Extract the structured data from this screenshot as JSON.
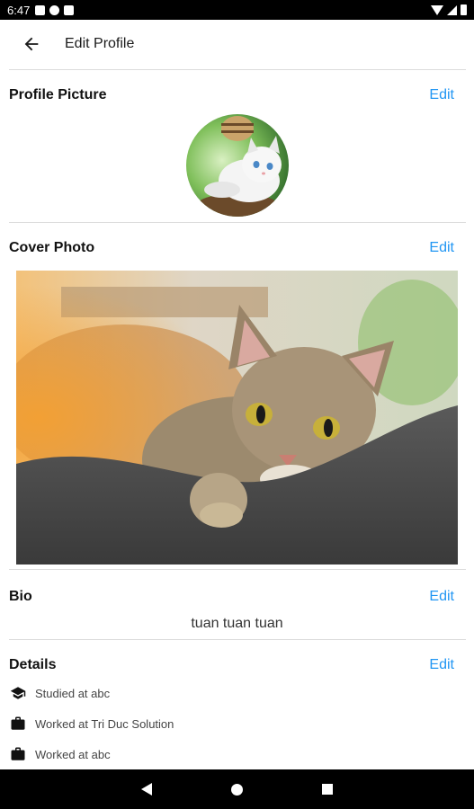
{
  "status_bar": {
    "time": "6:47"
  },
  "header": {
    "title": "Edit Profile"
  },
  "sections": {
    "profile_picture": {
      "title": "Profile Picture",
      "edit_label": "Edit"
    },
    "cover_photo": {
      "title": "Cover Photo",
      "edit_label": "Edit"
    },
    "bio": {
      "title": "Bio",
      "edit_label": "Edit",
      "text": "tuan tuan tuan"
    },
    "details": {
      "title": "Details",
      "edit_label": "Edit",
      "items": [
        {
          "icon": "graduation-cap-icon",
          "text": "Studied at abc"
        },
        {
          "icon": "briefcase-icon",
          "text": "Worked at Tri Duc Solution"
        },
        {
          "icon": "briefcase-icon",
          "text": "Worked at abc"
        }
      ]
    }
  },
  "colors": {
    "accent": "#2196f3",
    "divider": "#dcdcdc",
    "bars": "#000000"
  }
}
